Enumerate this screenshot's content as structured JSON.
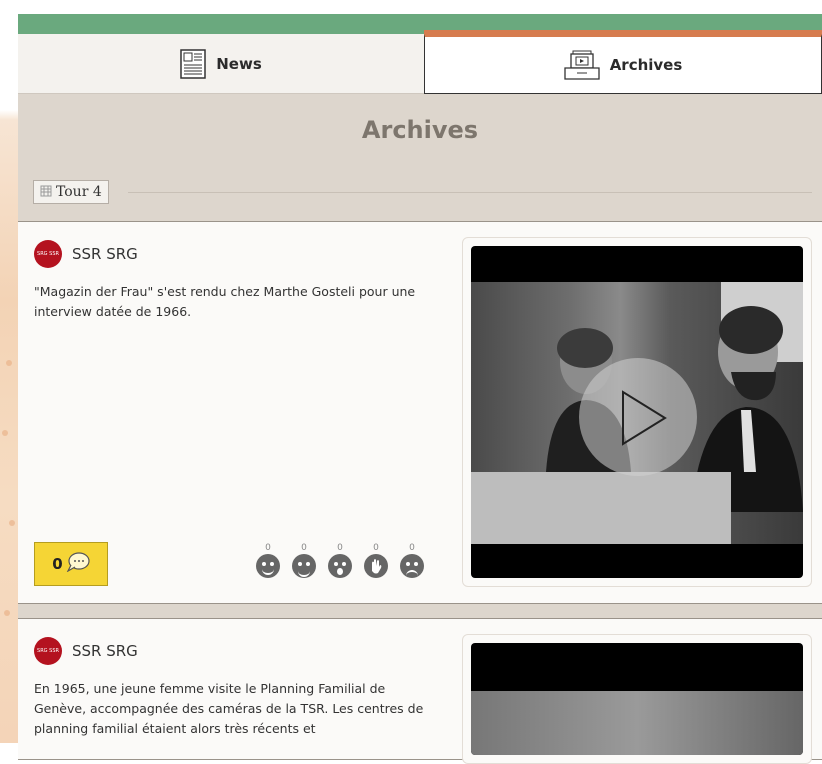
{
  "tabs": [
    {
      "label": "News",
      "icon": "newspaper-icon",
      "active": false
    },
    {
      "label": "Archives",
      "icon": "archive-video-icon",
      "active": true
    }
  ],
  "page": {
    "title": "Archives"
  },
  "filter": {
    "label": "Tour 4",
    "icon": "building-icon"
  },
  "posts": [
    {
      "source": "SSR SRG",
      "logo_text": "SRG SSR",
      "text": "\"Magazin der Frau\" s'est rendu chez Marthe Gosteli pour une interview datée de 1966.",
      "comments": "0",
      "reactions": [
        {
          "name": "love-reaction-icon",
          "count": "0"
        },
        {
          "name": "laugh-reaction-icon",
          "count": "0"
        },
        {
          "name": "wow-reaction-icon",
          "count": "0"
        },
        {
          "name": "clap-reaction-icon",
          "count": "0"
        },
        {
          "name": "angry-reaction-icon",
          "count": "0"
        }
      ]
    },
    {
      "source": "SSR SRG",
      "logo_text": "SRG SSR",
      "text": "En 1965, une jeune femme visite le Planning Familial de Genève, accompagnée des caméras de la TSR. Les centres de planning familial étaient alors très récents et"
    }
  ],
  "colors": {
    "accent_green": "#6aa97e",
    "accent_orange": "#d67c4f",
    "comment_yellow": "#f5d535",
    "brand_red": "#b4121f"
  }
}
